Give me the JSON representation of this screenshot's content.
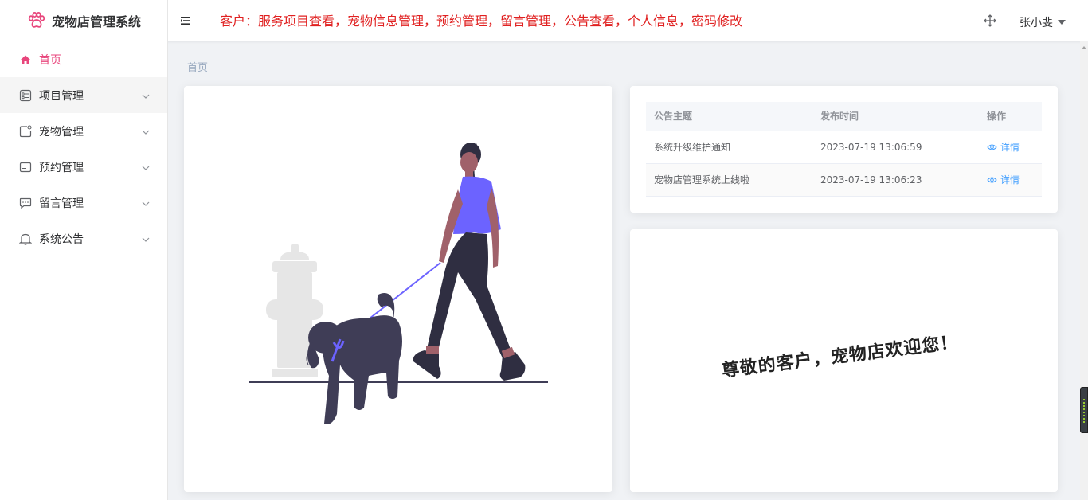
{
  "app": {
    "title": "宠物店管理系统"
  },
  "header": {
    "notice": "客户：服务项目查看，宠物信息管理，预约管理，留言管理，公告查看，个人信息，密码修改",
    "user": "张小斐"
  },
  "sidebar": {
    "items": [
      {
        "label": "首页",
        "icon": "home-icon"
      },
      {
        "label": "项目管理",
        "icon": "project-icon"
      },
      {
        "label": "宠物管理",
        "icon": "pet-icon"
      },
      {
        "label": "预约管理",
        "icon": "booking-icon"
      },
      {
        "label": "留言管理",
        "icon": "message-icon"
      },
      {
        "label": "系统公告",
        "icon": "bell-icon"
      }
    ]
  },
  "breadcrumb": "首页",
  "notices_table": {
    "headers": [
      "公告主题",
      "发布时间",
      "操作"
    ],
    "rows": [
      {
        "title": "系统升级维护通知",
        "time": "2023-07-19 13:06:59",
        "action": "详情"
      },
      {
        "title": "宠物店管理系统上线啦",
        "time": "2023-07-19 13:06:23",
        "action": "详情"
      }
    ]
  },
  "welcome": "尊敬的客户，宠物店欢迎您！",
  "colors": {
    "accent": "#e8467c",
    "notice": "#e02020",
    "link": "#409eff",
    "illustration": "#6c63ff"
  }
}
